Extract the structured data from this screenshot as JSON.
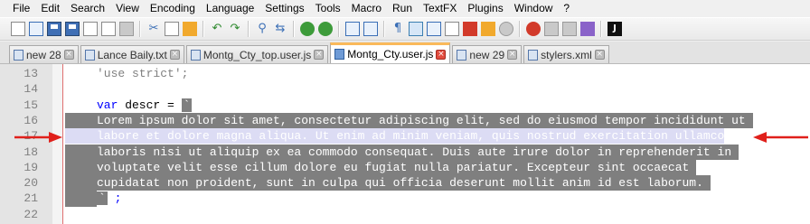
{
  "menu": [
    "File",
    "Edit",
    "Search",
    "View",
    "Encoding",
    "Language",
    "Settings",
    "Tools",
    "Macro",
    "Run",
    "TextFX",
    "Plugins",
    "Window",
    "?"
  ],
  "toolbar": {
    "icons": [
      "new-file-icon",
      "open-file-icon",
      "save-icon",
      "save-all-icon",
      "close-icon",
      "close-all-icon",
      "print-icon",
      "cut-icon",
      "copy-icon",
      "paste-icon",
      "undo-icon",
      "redo-icon",
      "find-icon",
      "replace-icon",
      "zoom-in-icon",
      "zoom-out-icon",
      "sync-scroll-icon",
      "word-wrap-icon",
      "show-all-chars-icon",
      "indent-guide-icon",
      "doc-map-icon",
      "function-list-icon",
      "folder-as-workspace-icon",
      "monitor-icon",
      "record-macro-icon",
      "stop-macro-icon",
      "play-macro-icon",
      "run-macro-multiple-icon",
      "save-macro-icon",
      "jslint-icon"
    ],
    "jslint_label": "J"
  },
  "tabs": [
    {
      "label": "new 28",
      "active": false
    },
    {
      "label": "Lance Baily.txt",
      "active": false
    },
    {
      "label": "Montg_Cty_top.user.js",
      "active": false
    },
    {
      "label": "Montg_Cty.user.js",
      "active": true
    },
    {
      "label": "new 29",
      "active": false
    },
    {
      "label": "stylers.xml",
      "active": false
    }
  ],
  "editor": {
    "lines": [
      {
        "num": "13",
        "text": "'use strict';"
      },
      {
        "num": "14",
        "text": ""
      },
      {
        "num": "15",
        "text": "var descr = `"
      },
      {
        "num": "16",
        "text": "Lorem ipsum dolor sit amet, consectetur adipiscing elit, sed do eiusmod tempor incididunt ut"
      },
      {
        "num": "17",
        "text": "labore et dolore magna aliqua. Ut enim ad minim veniam, quis nostrud exercitation ullamco"
      },
      {
        "num": "18",
        "text": "laboris nisi ut aliquip ex ea commodo consequat. Duis aute irure dolor in reprehenderit in"
      },
      {
        "num": "19",
        "text": "voluptate velit esse cillum dolore eu fugiat nulla pariatur. Excepteur sint occaecat"
      },
      {
        "num": "20",
        "text": "cupidatat non proident, sunt in culpa qui officia deserunt mollit anim id est laborum."
      },
      {
        "num": "21",
        "text": "` ;"
      },
      {
        "num": "22",
        "text": ""
      }
    ],
    "var_keyword": "var",
    "var_rest": " descr = ",
    "backtick": "`",
    "closing_tick": "`",
    "closing_rest": " ;"
  },
  "colors": {
    "selection": "#7f7f7f",
    "faint_selection": "#dcdcf4",
    "annotation_arrow": "#e0201b",
    "keyword": "#0000ff",
    "active_tab_accent": "#fab95b"
  }
}
